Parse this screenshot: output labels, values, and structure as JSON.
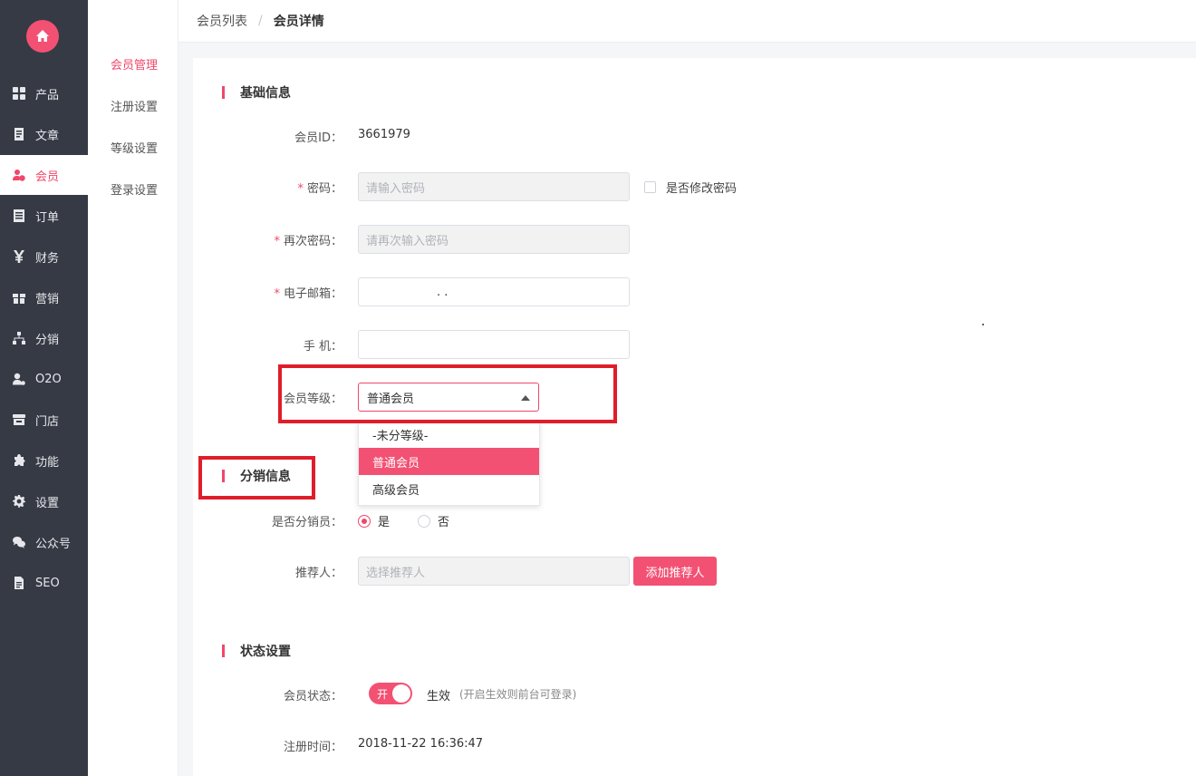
{
  "nav": {
    "items": [
      {
        "label": "产品",
        "icon": "grid-icon"
      },
      {
        "label": "文章",
        "icon": "document-icon"
      },
      {
        "label": "会员",
        "icon": "member-icon"
      },
      {
        "label": "订单",
        "icon": "order-icon"
      },
      {
        "label": "财务",
        "icon": "yen-icon"
      },
      {
        "label": "营销",
        "icon": "gift-icon"
      },
      {
        "label": "分销",
        "icon": "sitemap-icon"
      },
      {
        "label": "O2O",
        "icon": "user-pin-icon"
      },
      {
        "label": "门店",
        "icon": "store-icon"
      },
      {
        "label": "功能",
        "icon": "puzzle-icon"
      },
      {
        "label": "设置",
        "icon": "gear-icon"
      },
      {
        "label": "公众号",
        "icon": "wechat-icon"
      },
      {
        "label": "SEO",
        "icon": "file-icon"
      }
    ],
    "active_index": 2
  },
  "subnav": {
    "items": [
      "会员管理",
      "注册设置",
      "等级设置",
      "登录设置"
    ],
    "active_index": 0
  },
  "breadcrumb": {
    "parent": "会员列表",
    "separator": "/",
    "current": "会员详情"
  },
  "basic": {
    "title": "基础信息",
    "member_id_label": "会员ID：",
    "member_id_value": "3661979",
    "password_label": "密码：",
    "password_placeholder": "请输入密码",
    "change_password_label": "是否修改密码",
    "repeat_password_label": "再次密码：",
    "repeat_password_placeholder": "请再次输入密码",
    "email_label": "电子邮箱：",
    "email_value": ". .",
    "phone_label": "手 机：",
    "phone_value": "",
    "level_label": "会员等级：",
    "level_value": "普通会员",
    "level_options": [
      "-未分等级-",
      "普通会员",
      "高级会员"
    ],
    "level_selected_index": 1
  },
  "distribution": {
    "title": "分销信息",
    "is_distributor_label": "是否分销员：",
    "yes_label": "是",
    "no_label": "否",
    "referrer_label": "推荐人：",
    "referrer_placeholder": "选择推荐人",
    "add_referrer_button": "添加推荐人"
  },
  "status": {
    "title": "状态设置",
    "member_status_label": "会员状态：",
    "switch_label": "开",
    "switch_on": true,
    "status_text": "生效",
    "status_hint": "(开启生效则前台可登录)",
    "reg_time_label": "注册时间：",
    "reg_time_value": "2018-11-22 16:36:47"
  },
  "colors": {
    "accent": "#f25173",
    "sidebar_bg": "#363a45",
    "highlight_box": "#e01d2a"
  }
}
